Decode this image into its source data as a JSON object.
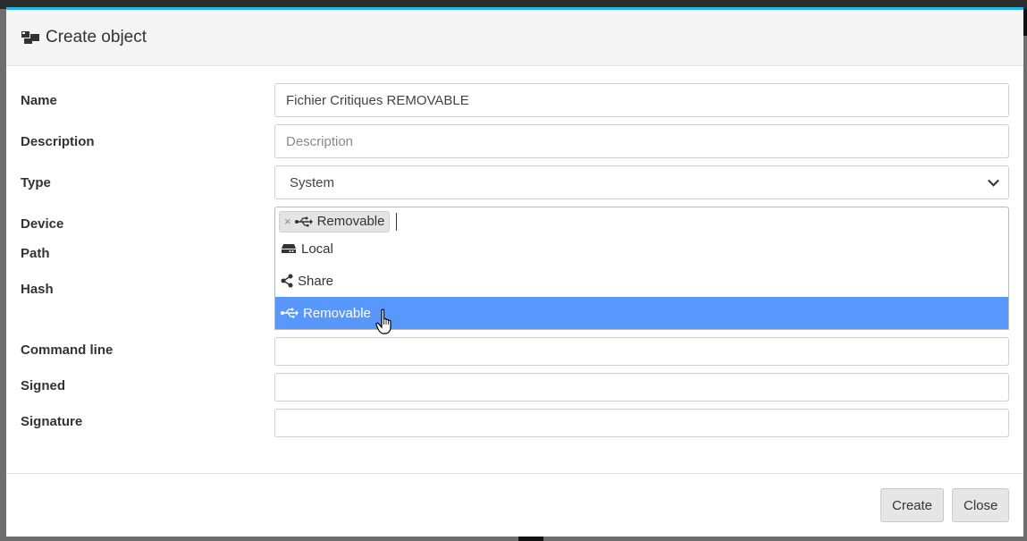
{
  "modal": {
    "title": "Create object",
    "title_icon": "object-icon"
  },
  "form": {
    "name": {
      "label": "Name",
      "value": "Fichier Critiques REMOVABLE"
    },
    "description": {
      "label": "Description",
      "placeholder": "Description"
    },
    "type": {
      "label": "Type",
      "selected": "System"
    },
    "device": {
      "label": "Device",
      "tag": {
        "label": "Removable",
        "remove": "×",
        "icon": "usb-icon"
      },
      "options": [
        {
          "label": "Local",
          "icon": "hdd-icon"
        },
        {
          "label": "Share",
          "icon": "share-icon"
        },
        {
          "label": "Removable",
          "icon": "usb-icon",
          "selected": true
        }
      ]
    },
    "path": {
      "label": "Path"
    },
    "hash": {
      "label": "Hash"
    },
    "command_line": {
      "label": "Command line",
      "value": ""
    },
    "signed": {
      "label": "Signed",
      "value": ""
    },
    "signature": {
      "label": "Signature",
      "value": ""
    }
  },
  "footer": {
    "create_label": "Create",
    "close_label": "Close"
  },
  "colors": {
    "accent_top": "#26b5e8",
    "option_selected": "#5897fb"
  }
}
